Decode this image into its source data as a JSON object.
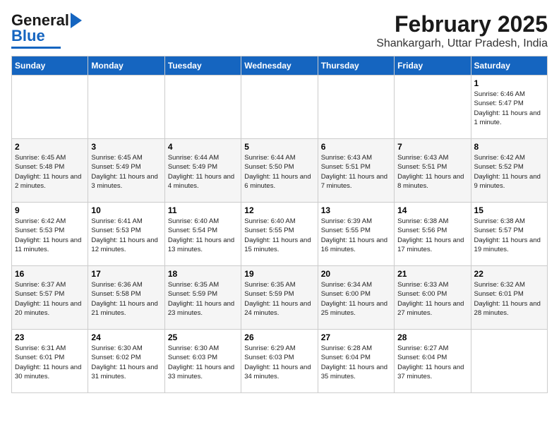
{
  "header": {
    "logo_general": "General",
    "logo_blue": "Blue",
    "month_year": "February 2025",
    "location": "Shankargarh, Uttar Pradesh, India"
  },
  "days_of_week": [
    "Sunday",
    "Monday",
    "Tuesday",
    "Wednesday",
    "Thursday",
    "Friday",
    "Saturday"
  ],
  "weeks": [
    [
      {
        "day": "",
        "info": ""
      },
      {
        "day": "",
        "info": ""
      },
      {
        "day": "",
        "info": ""
      },
      {
        "day": "",
        "info": ""
      },
      {
        "day": "",
        "info": ""
      },
      {
        "day": "",
        "info": ""
      },
      {
        "day": "1",
        "info": "Sunrise: 6:46 AM\nSunset: 5:47 PM\nDaylight: 11 hours and 1 minute."
      }
    ],
    [
      {
        "day": "2",
        "info": "Sunrise: 6:45 AM\nSunset: 5:48 PM\nDaylight: 11 hours and 2 minutes."
      },
      {
        "day": "3",
        "info": "Sunrise: 6:45 AM\nSunset: 5:49 PM\nDaylight: 11 hours and 3 minutes."
      },
      {
        "day": "4",
        "info": "Sunrise: 6:44 AM\nSunset: 5:49 PM\nDaylight: 11 hours and 4 minutes."
      },
      {
        "day": "5",
        "info": "Sunrise: 6:44 AM\nSunset: 5:50 PM\nDaylight: 11 hours and 6 minutes."
      },
      {
        "day": "6",
        "info": "Sunrise: 6:43 AM\nSunset: 5:51 PM\nDaylight: 11 hours and 7 minutes."
      },
      {
        "day": "7",
        "info": "Sunrise: 6:43 AM\nSunset: 5:51 PM\nDaylight: 11 hours and 8 minutes."
      },
      {
        "day": "8",
        "info": "Sunrise: 6:42 AM\nSunset: 5:52 PM\nDaylight: 11 hours and 9 minutes."
      }
    ],
    [
      {
        "day": "9",
        "info": "Sunrise: 6:42 AM\nSunset: 5:53 PM\nDaylight: 11 hours and 11 minutes."
      },
      {
        "day": "10",
        "info": "Sunrise: 6:41 AM\nSunset: 5:53 PM\nDaylight: 11 hours and 12 minutes."
      },
      {
        "day": "11",
        "info": "Sunrise: 6:40 AM\nSunset: 5:54 PM\nDaylight: 11 hours and 13 minutes."
      },
      {
        "day": "12",
        "info": "Sunrise: 6:40 AM\nSunset: 5:55 PM\nDaylight: 11 hours and 15 minutes."
      },
      {
        "day": "13",
        "info": "Sunrise: 6:39 AM\nSunset: 5:55 PM\nDaylight: 11 hours and 16 minutes."
      },
      {
        "day": "14",
        "info": "Sunrise: 6:38 AM\nSunset: 5:56 PM\nDaylight: 11 hours and 17 minutes."
      },
      {
        "day": "15",
        "info": "Sunrise: 6:38 AM\nSunset: 5:57 PM\nDaylight: 11 hours and 19 minutes."
      }
    ],
    [
      {
        "day": "16",
        "info": "Sunrise: 6:37 AM\nSunset: 5:57 PM\nDaylight: 11 hours and 20 minutes."
      },
      {
        "day": "17",
        "info": "Sunrise: 6:36 AM\nSunset: 5:58 PM\nDaylight: 11 hours and 21 minutes."
      },
      {
        "day": "18",
        "info": "Sunrise: 6:35 AM\nSunset: 5:59 PM\nDaylight: 11 hours and 23 minutes."
      },
      {
        "day": "19",
        "info": "Sunrise: 6:35 AM\nSunset: 5:59 PM\nDaylight: 11 hours and 24 minutes."
      },
      {
        "day": "20",
        "info": "Sunrise: 6:34 AM\nSunset: 6:00 PM\nDaylight: 11 hours and 25 minutes."
      },
      {
        "day": "21",
        "info": "Sunrise: 6:33 AM\nSunset: 6:00 PM\nDaylight: 11 hours and 27 minutes."
      },
      {
        "day": "22",
        "info": "Sunrise: 6:32 AM\nSunset: 6:01 PM\nDaylight: 11 hours and 28 minutes."
      }
    ],
    [
      {
        "day": "23",
        "info": "Sunrise: 6:31 AM\nSunset: 6:01 PM\nDaylight: 11 hours and 30 minutes."
      },
      {
        "day": "24",
        "info": "Sunrise: 6:30 AM\nSunset: 6:02 PM\nDaylight: 11 hours and 31 minutes."
      },
      {
        "day": "25",
        "info": "Sunrise: 6:30 AM\nSunset: 6:03 PM\nDaylight: 11 hours and 33 minutes."
      },
      {
        "day": "26",
        "info": "Sunrise: 6:29 AM\nSunset: 6:03 PM\nDaylight: 11 hours and 34 minutes."
      },
      {
        "day": "27",
        "info": "Sunrise: 6:28 AM\nSunset: 6:04 PM\nDaylight: 11 hours and 35 minutes."
      },
      {
        "day": "28",
        "info": "Sunrise: 6:27 AM\nSunset: 6:04 PM\nDaylight: 11 hours and 37 minutes."
      },
      {
        "day": "",
        "info": ""
      }
    ]
  ]
}
